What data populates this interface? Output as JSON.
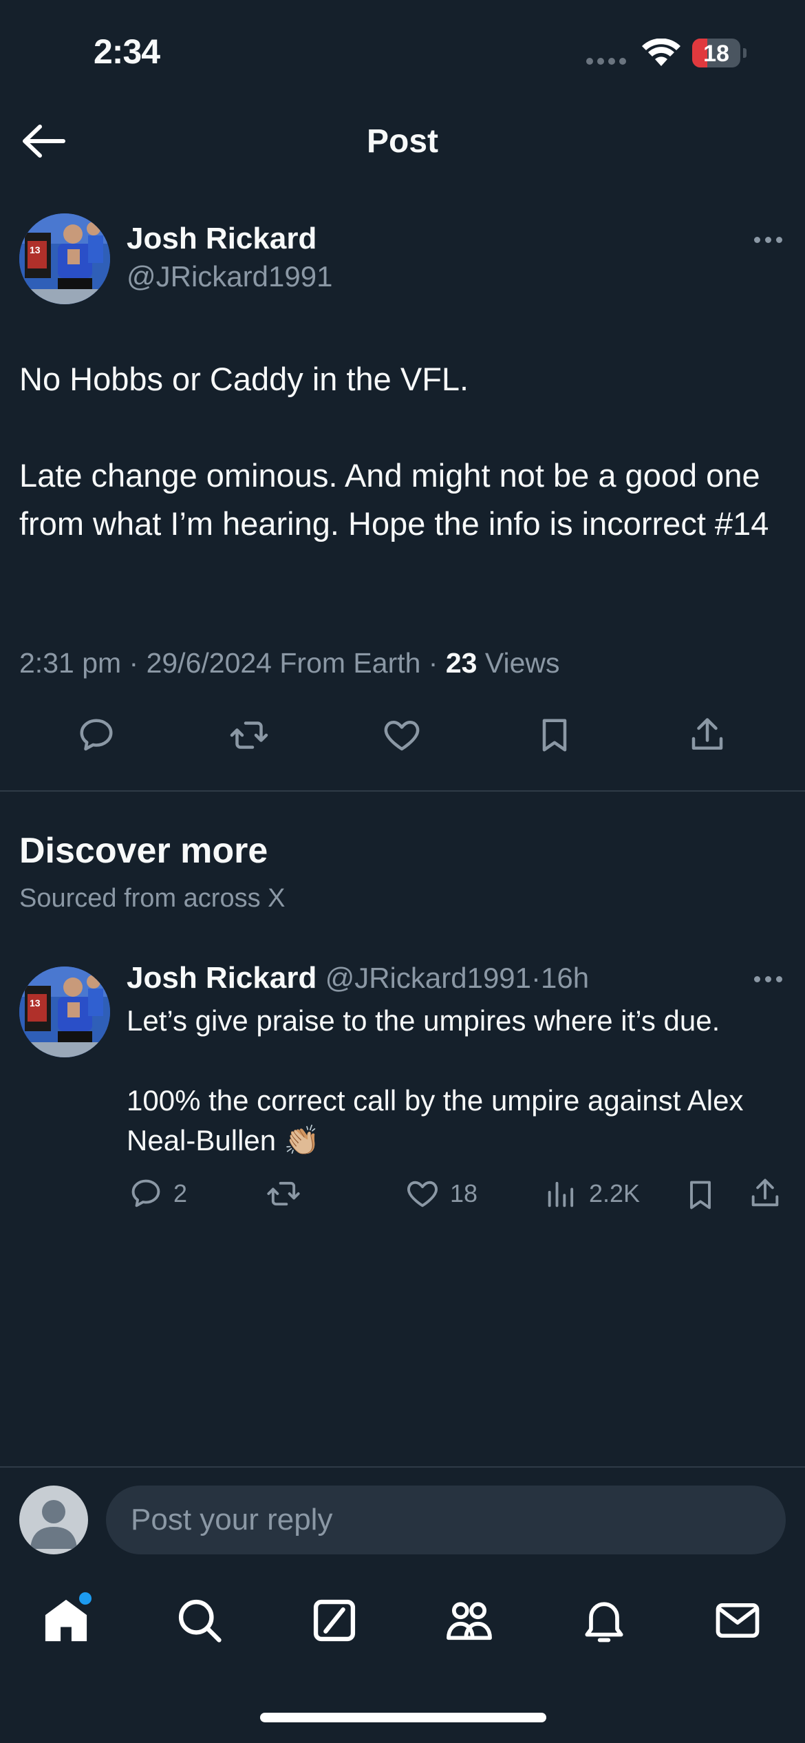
{
  "status_bar": {
    "time": "2:34",
    "battery": "18"
  },
  "header": {
    "title": "Post"
  },
  "post": {
    "author_name": "Josh Rickard",
    "author_handle": "@JRickard1991",
    "text": "No Hobbs or Caddy in the VFL.\n\nLate change ominous. And might not be a good one from what I’m hearing. Hope the info is incorrect #14",
    "meta_prefix": "2:31 pm · 29/6/2024 From Earth · ",
    "views_count": "23",
    "views_label": " Views"
  },
  "discover": {
    "title": "Discover more",
    "subtitle": "Sourced from across X"
  },
  "recommended_post": {
    "author_name": "Josh Rickard",
    "author_handle": "@JRickard1991",
    "dot": "·",
    "time": "16h",
    "text": "Let’s give praise to the umpires where it’s due.\n\n100% the correct call by the umpire against Alex Neal-Bullen 👏🏼",
    "replies": "2",
    "likes": "18",
    "views": "2.2K"
  },
  "reply": {
    "placeholder": "Post your reply"
  },
  "icons": {
    "back": "arrow-left-icon",
    "more": "more-horizontal-icon",
    "reply": "comment-icon",
    "repost": "repost-icon",
    "like": "heart-icon",
    "bookmark": "bookmark-icon",
    "share": "share-icon",
    "views": "analytics-icon",
    "nav": [
      "home-icon",
      "search-icon",
      "grok-icon",
      "communities-icon",
      "notifications-icon",
      "messages-icon"
    ]
  },
  "colors": {
    "background": "#15202b",
    "accent": "#1d9bf0",
    "muted": "#8b98a5",
    "text": "#f7f9f9"
  }
}
